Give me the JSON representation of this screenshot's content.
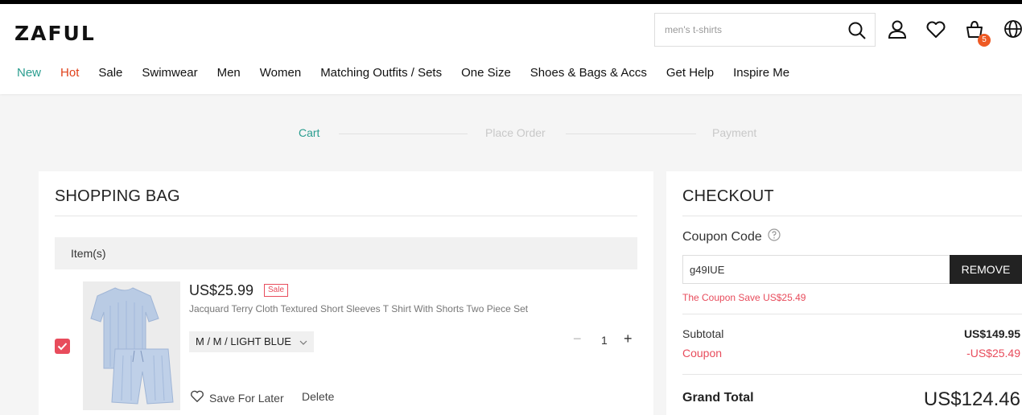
{
  "brand": "ZAFUL",
  "search": {
    "placeholder": "men's t-shirts"
  },
  "header_icons": [
    "search-icon",
    "user-icon",
    "heart-icon",
    "cart-icon",
    "globe-icon"
  ],
  "cart_count": "5",
  "nav": [
    "New",
    "Hot",
    "Sale",
    "Swimwear",
    "Men",
    "Women",
    "Matching Outfits / Sets",
    "One Size",
    "Shoes & Bags & Accs",
    "Get Help",
    "Inspire Me"
  ],
  "colors": {
    "new": "#2a9d8f",
    "hot": "#e0421b",
    "accent": "#e84c5c",
    "step_active": "#2a9d8f"
  },
  "steps": [
    "Cart",
    "Place Order",
    "Payment"
  ],
  "bag": {
    "title": "SHOPPING BAG",
    "items_header": "Item(s)",
    "item": {
      "price": "US$25.99",
      "tag": "Sale",
      "name": "Jacquard Terry Cloth Textured Short Sleeves T Shirt With Shorts Two Piece Set",
      "variant": "M / M / LIGHT BLUE",
      "quantity": "1",
      "save_later": "Save For Later",
      "delete": "Delete",
      "checked": true
    }
  },
  "checkout": {
    "title": "CHECKOUT",
    "coupon_label": "Coupon Code",
    "coupon_value": "g49IUE",
    "remove_label": "REMOVE",
    "coupon_note": "The Coupon Save US$25.49",
    "subtotal_label": "Subtotal",
    "subtotal_value": "US$149.95",
    "coupon_row_label": "Coupon",
    "coupon_row_value": "-US$25.49",
    "grand_total_label": "Grand Total",
    "grand_total_value": "US$124.46"
  }
}
